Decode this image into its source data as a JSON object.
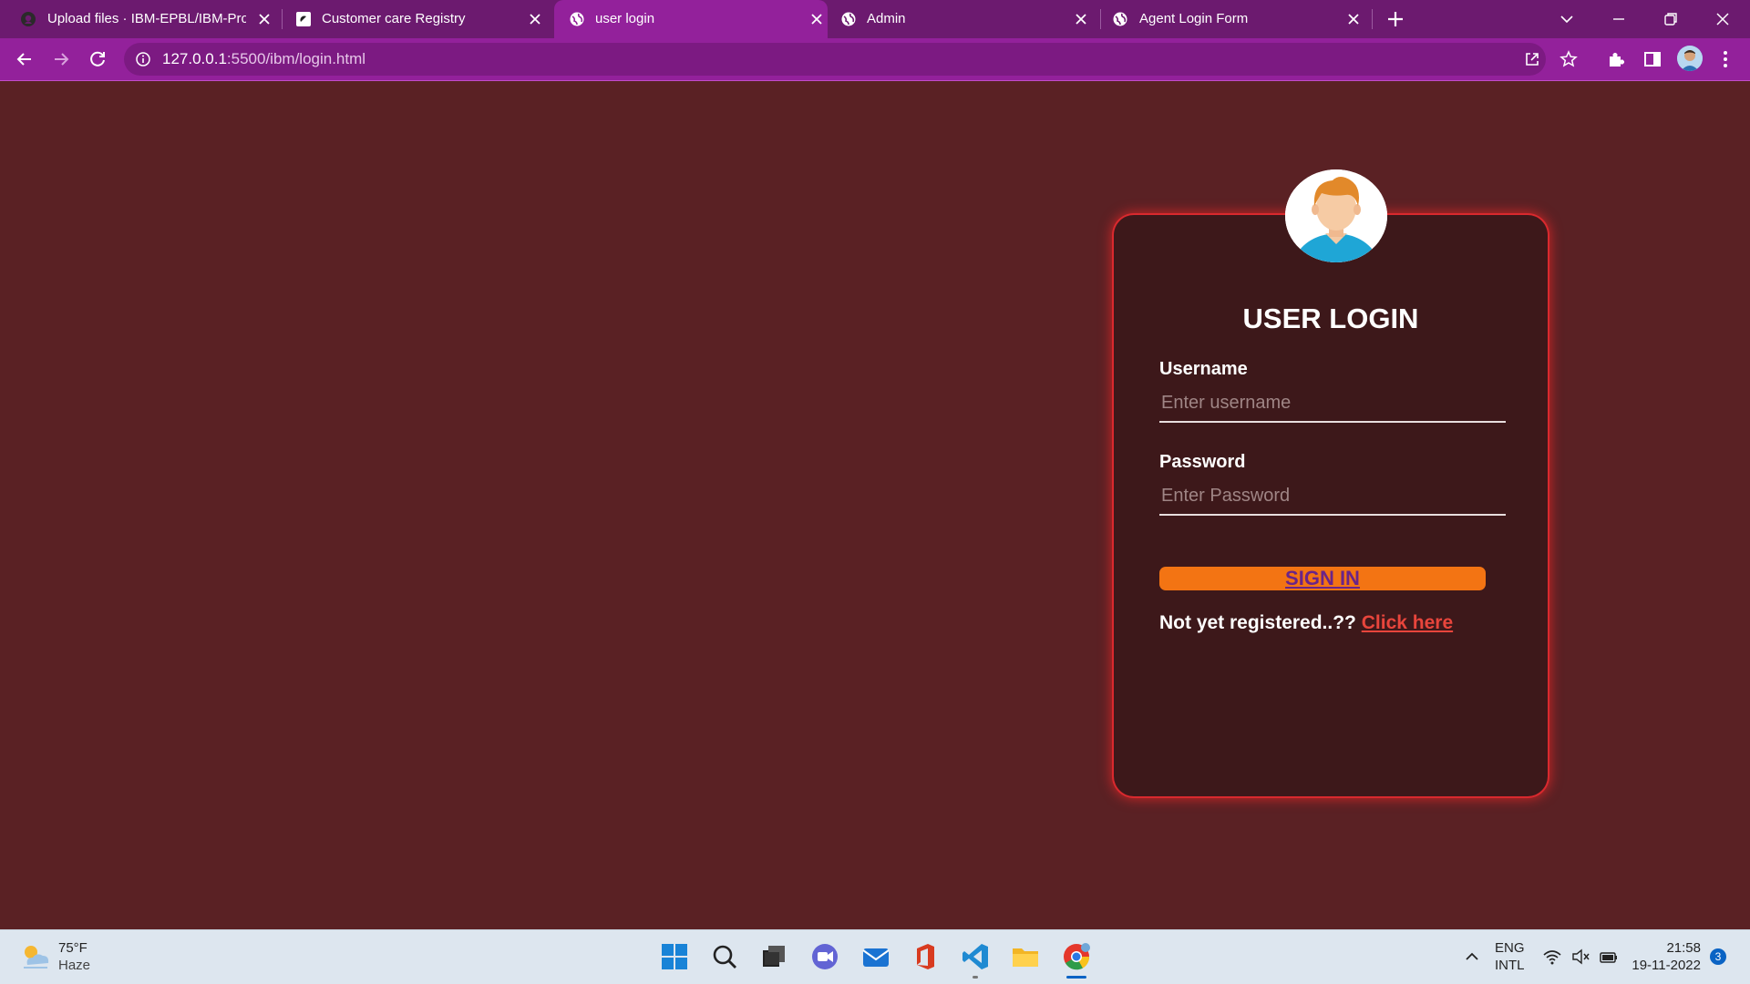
{
  "browser": {
    "tabs": [
      {
        "title": "Upload files · IBM-EPBL/IBM-Proj",
        "icon": "github-icon",
        "active": false
      },
      {
        "title": "Customer care Registry",
        "icon": "site-logo-icon",
        "active": false
      },
      {
        "title": "user login",
        "icon": "globe-icon",
        "active": true
      },
      {
        "title": "Admin",
        "icon": "globe-icon",
        "active": false
      },
      {
        "title": "Agent Login Form",
        "icon": "globe-icon",
        "active": false
      }
    ],
    "address": {
      "host": "127.0.0.1",
      "path": ":5500/ibm/login.html"
    },
    "colors": {
      "frame": "#6c1a6f",
      "active_tab": "#93219b",
      "omnibox": "#7c1a82"
    }
  },
  "page": {
    "background": "#5a2124",
    "login": {
      "title": "USER LOGIN",
      "username_label": "Username",
      "username_placeholder": "Enter username",
      "password_label": "Password",
      "password_placeholder": "Enter Password",
      "signin_label": "SIGN IN",
      "register_prompt": "Not yet registered..??",
      "register_link": "Click here"
    },
    "colors": {
      "card": "#3d181a",
      "glow": "#d9292e",
      "button": "#f37413",
      "link": "#e8453c"
    }
  },
  "taskbar": {
    "weather": {
      "temp": "75°F",
      "condition": "Haze"
    },
    "language": {
      "line1": "ENG",
      "line2": "INTL"
    },
    "clock": {
      "time": "21:58",
      "date": "19-11-2022"
    },
    "notifications": "3"
  }
}
